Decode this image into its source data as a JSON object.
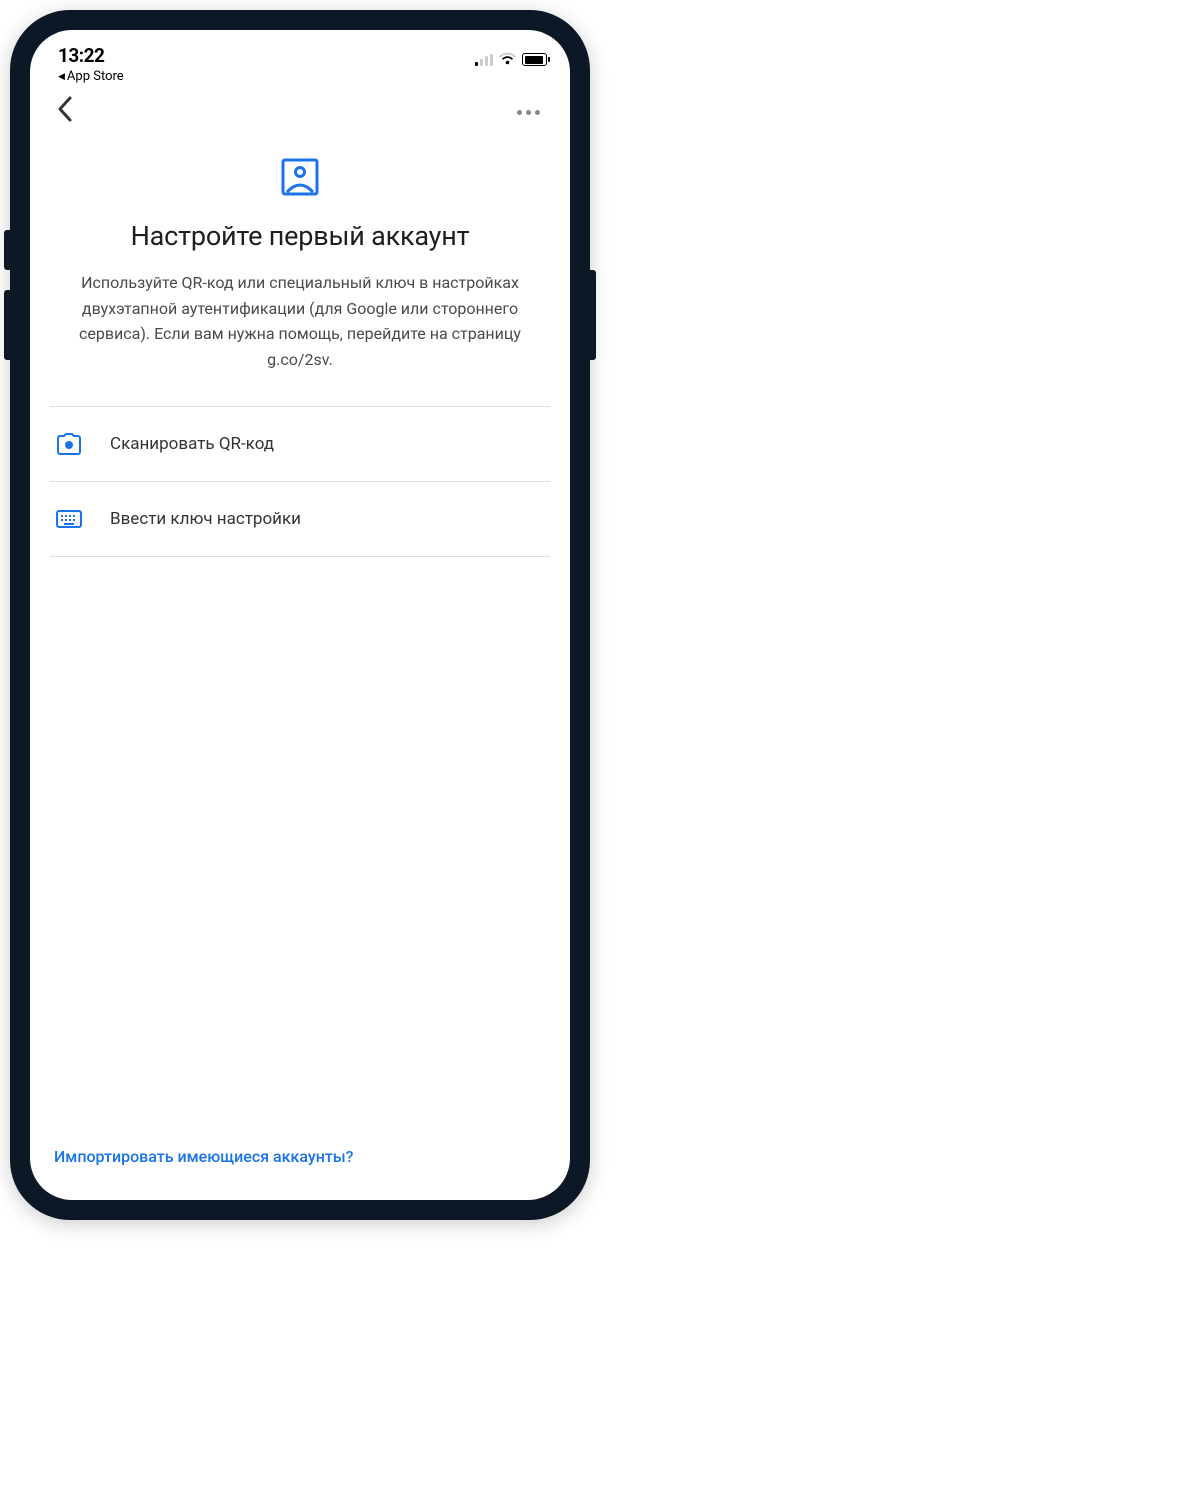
{
  "status_bar": {
    "time": "13:22",
    "back_app_label": "App Store"
  },
  "page": {
    "title": "Настройте первый аккаунт",
    "description": "Используйте QR-код или специальный ключ в настройках двухэтапной аутентификации (для Google или стороннего сервиса). Если вам нужна помощь, перейдите на страницу g.co/2sv."
  },
  "options": {
    "scan_qr": "Сканировать QR-код",
    "enter_key": "Ввести ключ настройки"
  },
  "footer": {
    "import_link": "Импортировать имеющиеся аккаунты?"
  },
  "colors": {
    "accent": "#1a73e8"
  }
}
